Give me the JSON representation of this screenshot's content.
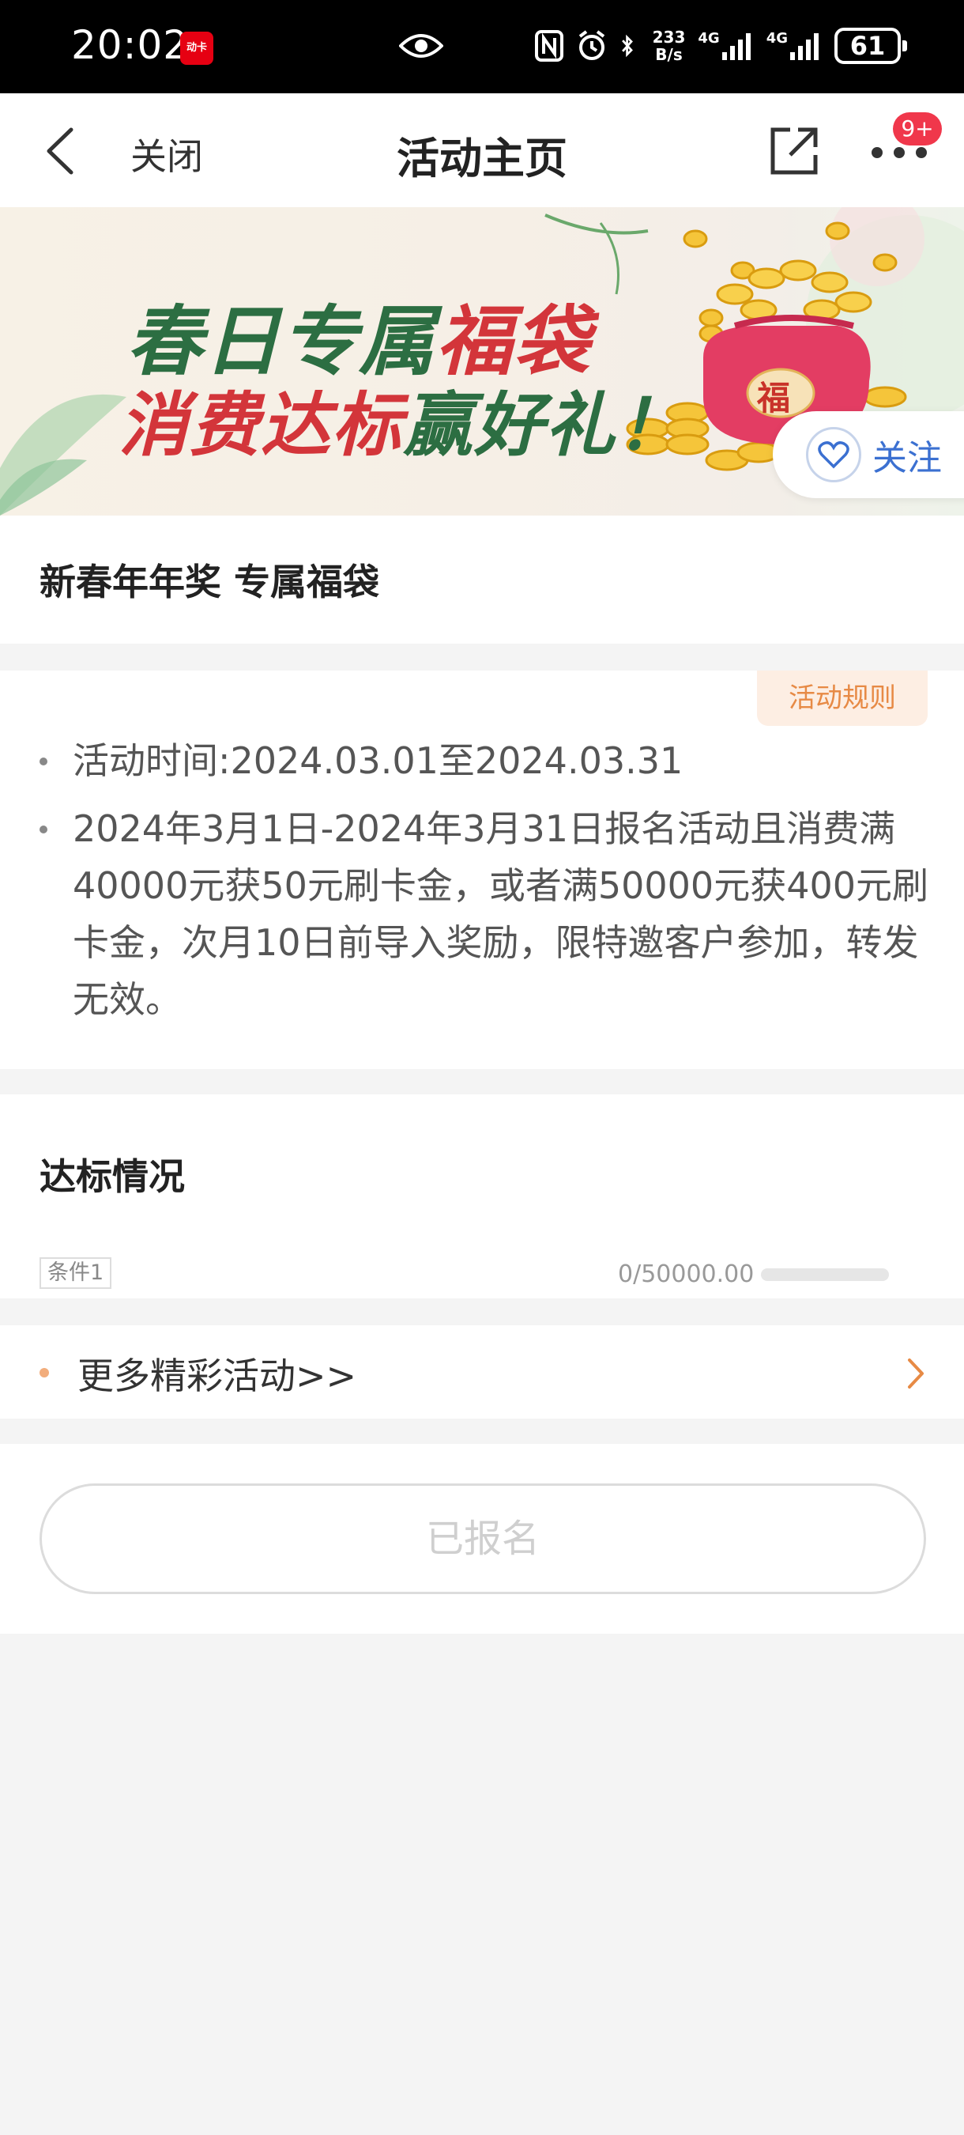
{
  "status_bar": {
    "time": "20:02",
    "app_icon_text": "动卡",
    "speed_top": "233",
    "speed_bottom": "B/s",
    "net1": "4G",
    "net2": "4G",
    "battery": "61"
  },
  "nav": {
    "close_label": "关闭",
    "title": "活动主页",
    "badge": "9+"
  },
  "banner": {
    "line1_a": "春日专属",
    "line1_b": "福袋",
    "line2_a": "消费达标",
    "line2_b": "赢好礼！",
    "bag_char": "福",
    "follow_label": "关注"
  },
  "title_card": {
    "title": "新春年年奖 专属福袋"
  },
  "rules": {
    "button_label": "活动规则",
    "items": [
      "活动时间:2024.03.01至2024.03.31",
      "2024年3月1日-2024年3月31日报名活动且消费满40000元获50元刷卡金，或者满50000元获400元刷卡金，次月10日前导入奖励，限特邀客户参加，转发无效。"
    ]
  },
  "progress": {
    "title": "达标情况",
    "condition_label": "条件1",
    "value_text": "0/50000.00",
    "fraction": 0
  },
  "more": {
    "label": "更多精彩活动>>"
  },
  "signup": {
    "label": "已报名"
  },
  "colors": {
    "accent_orange": "#e78a45",
    "badge_red": "#f0374b",
    "follow_blue": "#3b70d1",
    "banner_green": "#2c6e42",
    "banner_red": "#d3353a"
  }
}
